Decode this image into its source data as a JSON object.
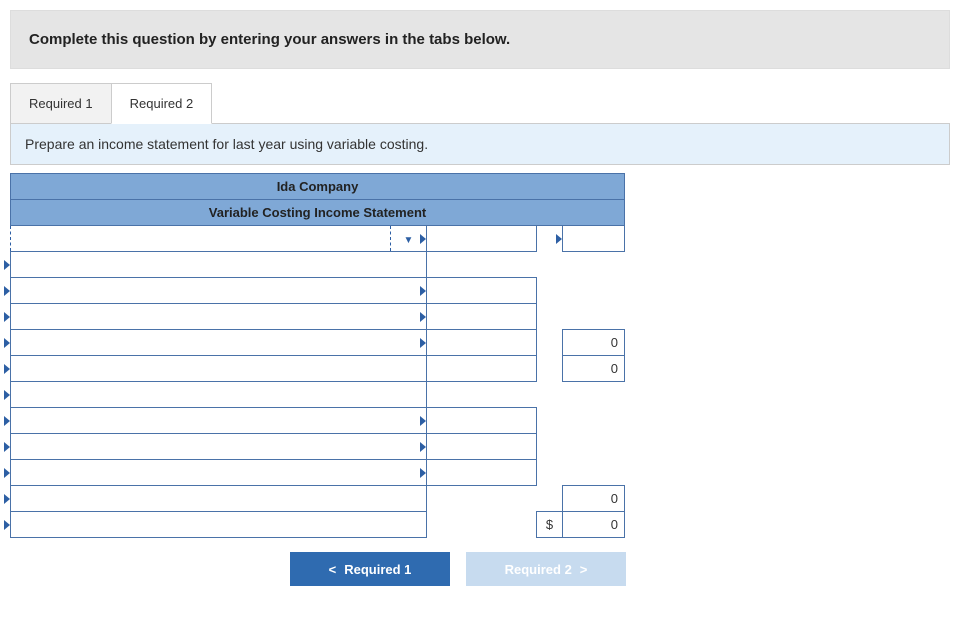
{
  "instruction": "Complete this question by entering your answers in the tabs below.",
  "tabs": {
    "t1": "Required 1",
    "t2": "Required 2"
  },
  "prompt": "Prepare an income statement for last year using variable costing.",
  "sheet": {
    "company": "Ida Company",
    "title": "Variable Costing Income Statement",
    "currency": "$",
    "vals": {
      "r5c3": "0",
      "r6c3": "0",
      "r11c3": "0",
      "r12c3": "0"
    }
  },
  "nav": {
    "prev": "Required 1",
    "next": "Required 2"
  }
}
